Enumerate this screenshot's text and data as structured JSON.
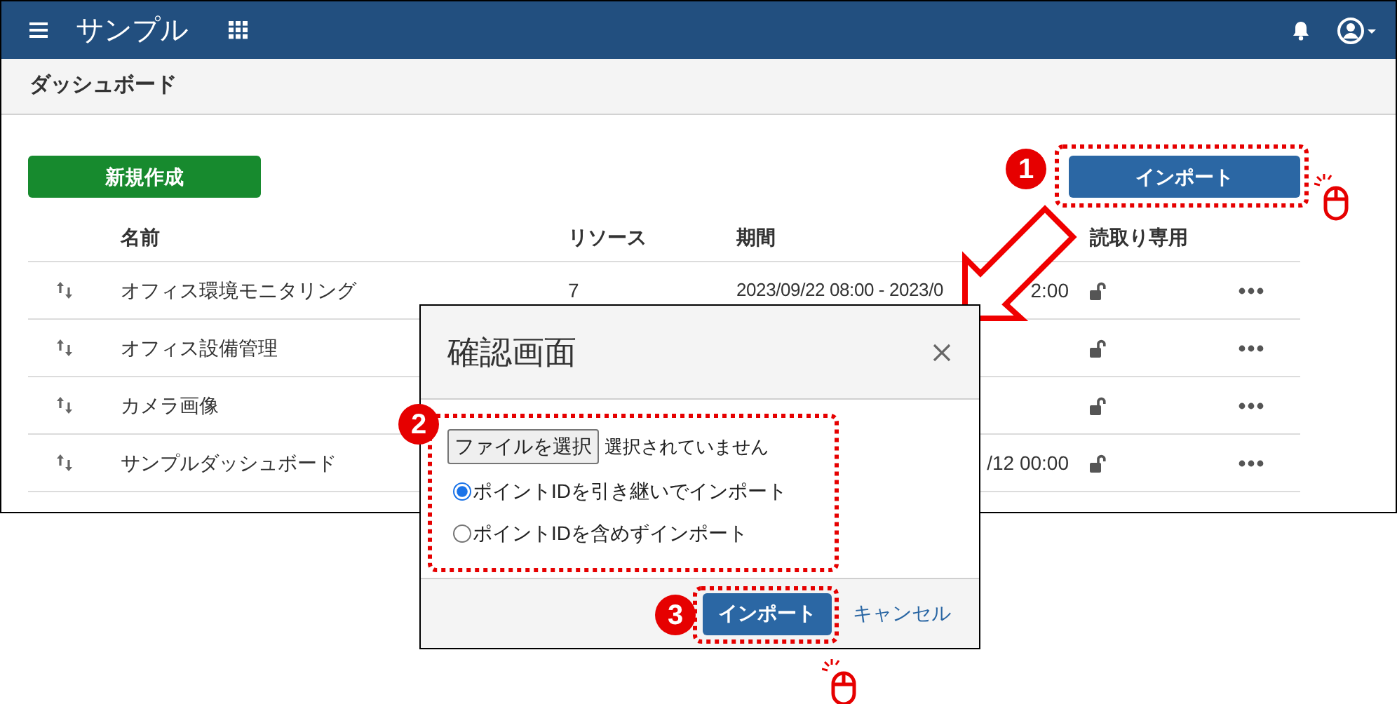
{
  "header": {
    "app_title": "サンプル"
  },
  "page_title": "ダッシュボード",
  "new_button": "新規作成",
  "import_button": "インポート",
  "table": {
    "columns": [
      "名前",
      "リソース",
      "期間",
      "読取り専用"
    ],
    "rows": [
      {
        "name": "オフィス環境モニタリング",
        "resources": "7",
        "period_start": "2023/09/22 08:00 - 2023/0",
        "period_end": "2:00"
      },
      {
        "name": "オフィス設備管理"
      },
      {
        "name": "カメラ画像"
      },
      {
        "name": "サンプルダッシュボード",
        "period_end": "/12 00:00"
      }
    ]
  },
  "dialog": {
    "title": "確認画面",
    "file_button": "ファイルを選択",
    "file_status": "選択されていません",
    "options": [
      {
        "label": "ポイントIDを引き継いでインポート",
        "selected": true
      },
      {
        "label": "ポイントIDを含めずインポート",
        "selected": false
      }
    ],
    "confirm_button": "インポート",
    "cancel_link": "キャンセル"
  },
  "annotations": {
    "steps": [
      {
        "number": "1"
      },
      {
        "number": "2"
      },
      {
        "number": "3"
      }
    ]
  }
}
